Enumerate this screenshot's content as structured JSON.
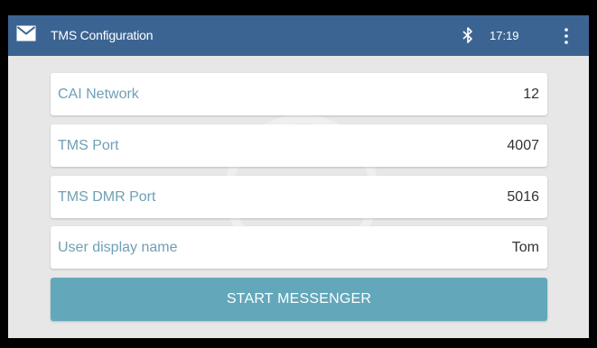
{
  "app_bar": {
    "title": "TMS Configuration",
    "app_icon": "envelope-icon",
    "status_icon": "bluetooth-icon",
    "clock": "17:19",
    "menu_icon": "overflow-menu-icon"
  },
  "fields": [
    {
      "label": "CAI Network",
      "value": "12"
    },
    {
      "label": "TMS Port",
      "value": "4007"
    },
    {
      "label": "TMS DMR Port",
      "value": "5016"
    },
    {
      "label": "User display name",
      "value": "Tom"
    }
  ],
  "start_button": {
    "label": "START MESSENGER"
  },
  "colors": {
    "app_bar": "#3c6493",
    "background": "#e7e7e7",
    "label": "#6fa0b5",
    "button": "#62a7ba"
  }
}
